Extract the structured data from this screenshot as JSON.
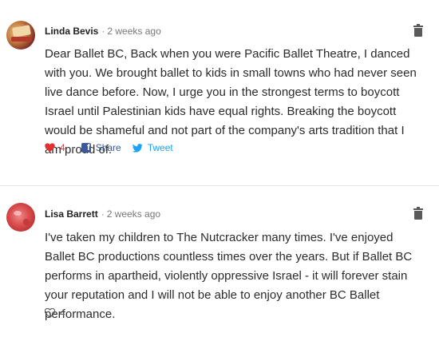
{
  "comments": [
    {
      "author": "Linda Bevis",
      "time": "2 weeks ago",
      "text": "Dear Ballet BC, Back when you were Pacific Ballet Theatre, I danced with you. We brought ballet to kids in small towns who had never seen live dance before. Now, I urge you in the strongest terms to boycott Israel until Palestinian kids have equal rights. Breaking the boycott would be shameful and not part of the company's arts tradition that I am proud of.",
      "likes": "4",
      "liked": true,
      "share_label": "Share",
      "tweet_label": "Tweet"
    },
    {
      "author": "Lisa Barrett",
      "time": "2 weeks ago",
      "text": "I've taken my children to The Nutcracker many times. I've enjoyed Ballet BC productions countless times over the years. But if Ballet BC performs in apartheid, violently oppressive Israel - it will forever stain your reputation and I will not be able to enjoy another BC Ballet performance.",
      "likes": "4",
      "liked": false
    }
  ],
  "colors": {
    "heart_liked": "#e03030",
    "facebook": "#3b5998",
    "twitter": "#1da1f2"
  },
  "icons": [
    "heart-icon",
    "facebook-icon",
    "twitter-icon",
    "trash-icon",
    "avatar"
  ]
}
